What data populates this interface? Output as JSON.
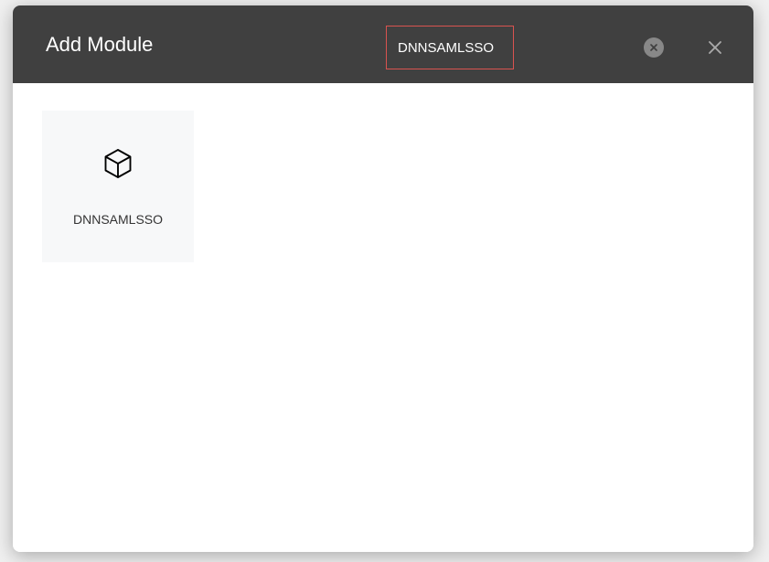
{
  "header": {
    "title": "Add Module",
    "search_value": "DNNSAMLSSO"
  },
  "modules": [
    {
      "label": "DNNSAMLSSO"
    }
  ]
}
